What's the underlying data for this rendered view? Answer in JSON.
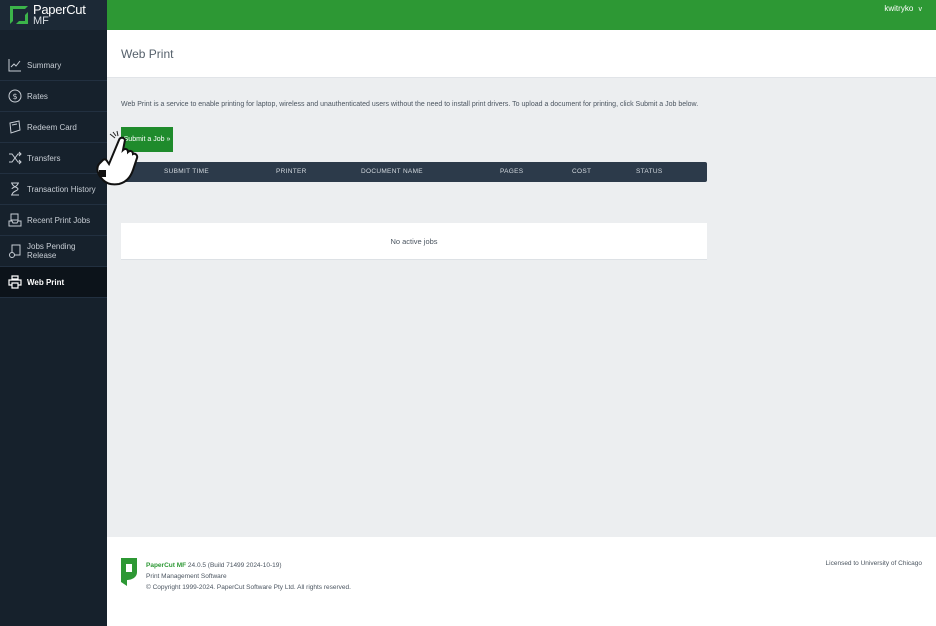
{
  "brand": {
    "name": "PaperCut",
    "product": "MF"
  },
  "header": {
    "user": "kwitryko",
    "user_chevron": "v"
  },
  "sidebar": {
    "items": [
      {
        "label": "Summary",
        "icon": "chart-line-icon"
      },
      {
        "label": "Rates",
        "icon": "dollar-circle-icon"
      },
      {
        "label": "Redeem Card",
        "icon": "card-icon"
      },
      {
        "label": "Transfers",
        "icon": "shuffle-icon"
      },
      {
        "label": "Transaction History",
        "icon": "hourglass-icon"
      },
      {
        "label": "Recent Print Jobs",
        "icon": "tray-icon"
      },
      {
        "label": "Jobs Pending Release",
        "icon": "pending-doc-icon"
      },
      {
        "label": "Web Print",
        "icon": "printer-icon",
        "active": true
      }
    ]
  },
  "page": {
    "title": "Web Print",
    "intro": "Web Print is a service to enable printing for laptop, wireless and unauthenticated users without the need to install print drivers. To upload a document for printing, click Submit a Job below.",
    "submit_label": "Submit a Job »"
  },
  "table": {
    "columns": [
      "SUBMIT TIME",
      "PRINTER",
      "DOCUMENT NAME",
      "PAGES",
      "COST",
      "STATUS"
    ],
    "empty_message": "No active jobs"
  },
  "footer": {
    "brand": "PaperCut MF",
    "version": "24.0.5 (Build 71499 2024-10-19)",
    "tagline": "Print Management Software",
    "copyright": "© Copyright 1999-2024. PaperCut Software Pty Ltd. All rights reserved.",
    "license": "Licensed to University of Chicago"
  },
  "colors": {
    "topbar": "#2d9834",
    "sidebar": "#16212c",
    "table_header": "#2c3a4a",
    "button": "#1f8b2c"
  }
}
